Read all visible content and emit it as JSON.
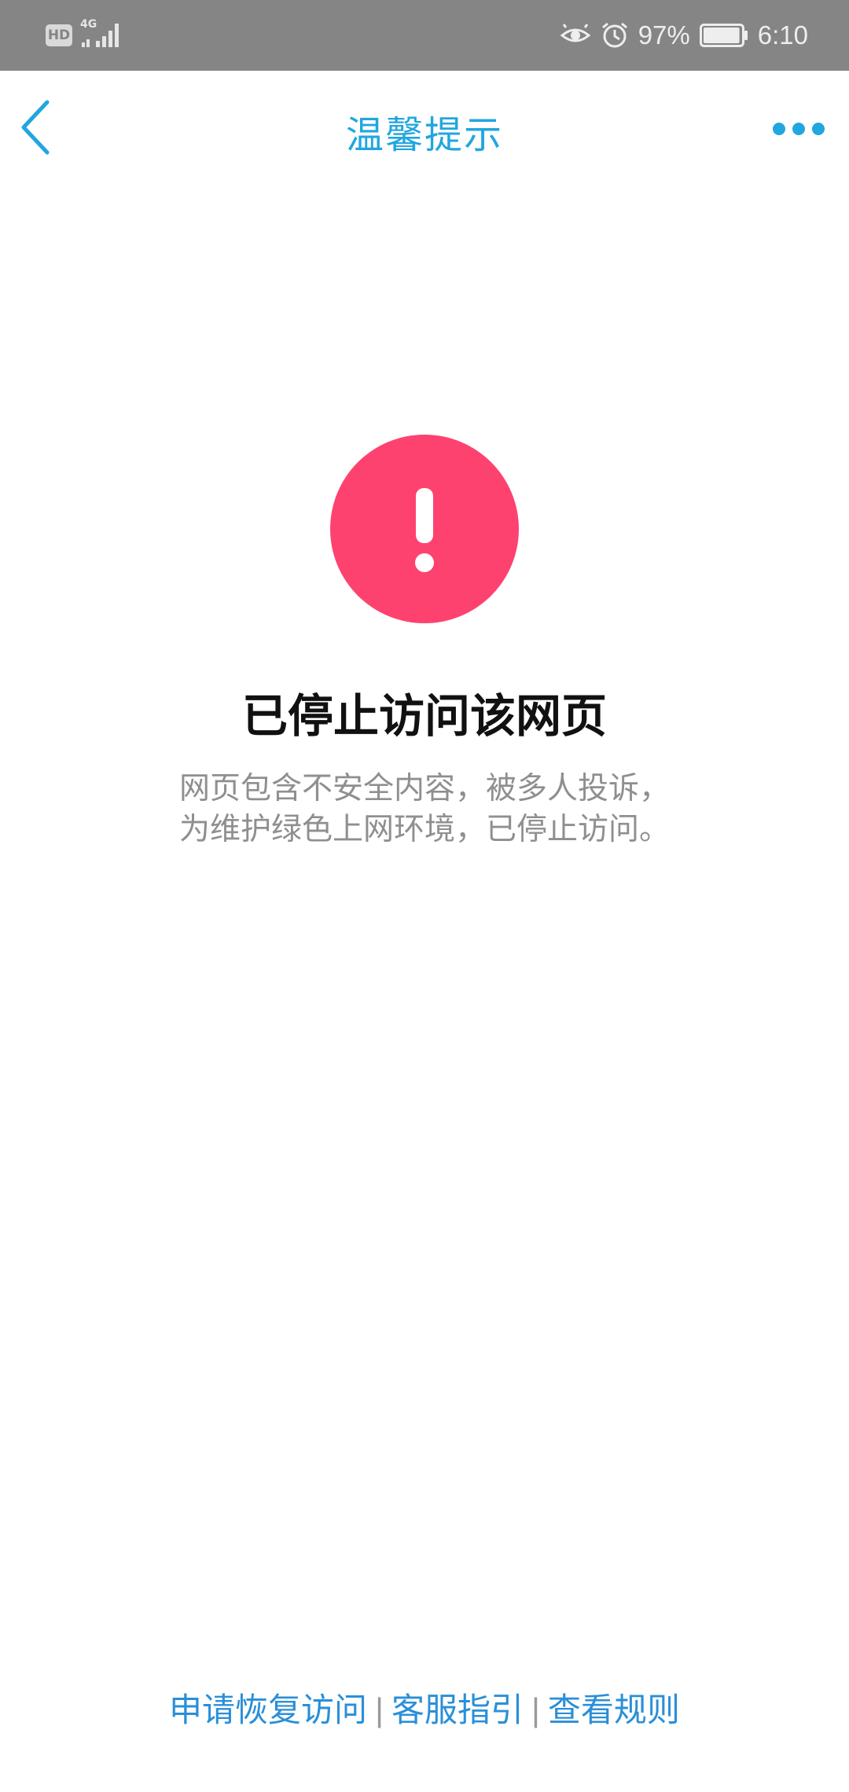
{
  "status_bar": {
    "hd": "HD",
    "network": "4G",
    "battery_percent": "97%",
    "time": "6:10",
    "battery_level": 0.97
  },
  "nav": {
    "title": "温馨提示",
    "back_icon": "chevron-left-icon",
    "more_icon": "more-dots-icon"
  },
  "content": {
    "icon": "exclamation-icon",
    "heading": "已停止访问该网页",
    "description_line1": "网页包含不安全内容，被多人投诉，",
    "description_line2": "为维护绿色上网环境，已停止访问。"
  },
  "footer": {
    "link_restore": "申请恢复访问",
    "link_support": "客服指引",
    "link_rules": "查看规则",
    "separator": "|"
  },
  "colors": {
    "accent": "#21a6df",
    "warning": "#fe426f",
    "status_bar_bg": "#858585",
    "link": "#2a8fd8"
  }
}
